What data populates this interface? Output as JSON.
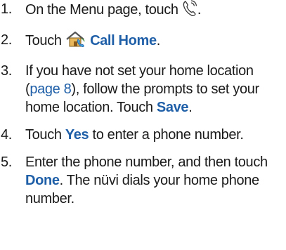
{
  "steps": [
    {
      "num": "1.",
      "pre": "On the Menu page, touch",
      "post": "."
    },
    {
      "num": "2.",
      "pre": "Touch",
      "label": "Call Home",
      "post": "."
    },
    {
      "num": "3.",
      "pre": "If you have not set your home location (",
      "link": "page 8",
      "mid": "), follow the prompts to set your home location. Touch",
      "label": "Save",
      "post": "."
    },
    {
      "num": "4.",
      "pre": "Touch",
      "label": "Yes",
      "post": "to enter a phone number."
    },
    {
      "num": "5.",
      "pre": "Enter the phone number, and then touch",
      "label": "Done",
      "post": ". The nüvi dials your home phone number."
    }
  ],
  "icons": {
    "phone": "phone-handset-icon",
    "home": "home-phone-icon"
  },
  "colors": {
    "text": "#1a1a1a",
    "accent": "#1f5fa8"
  }
}
